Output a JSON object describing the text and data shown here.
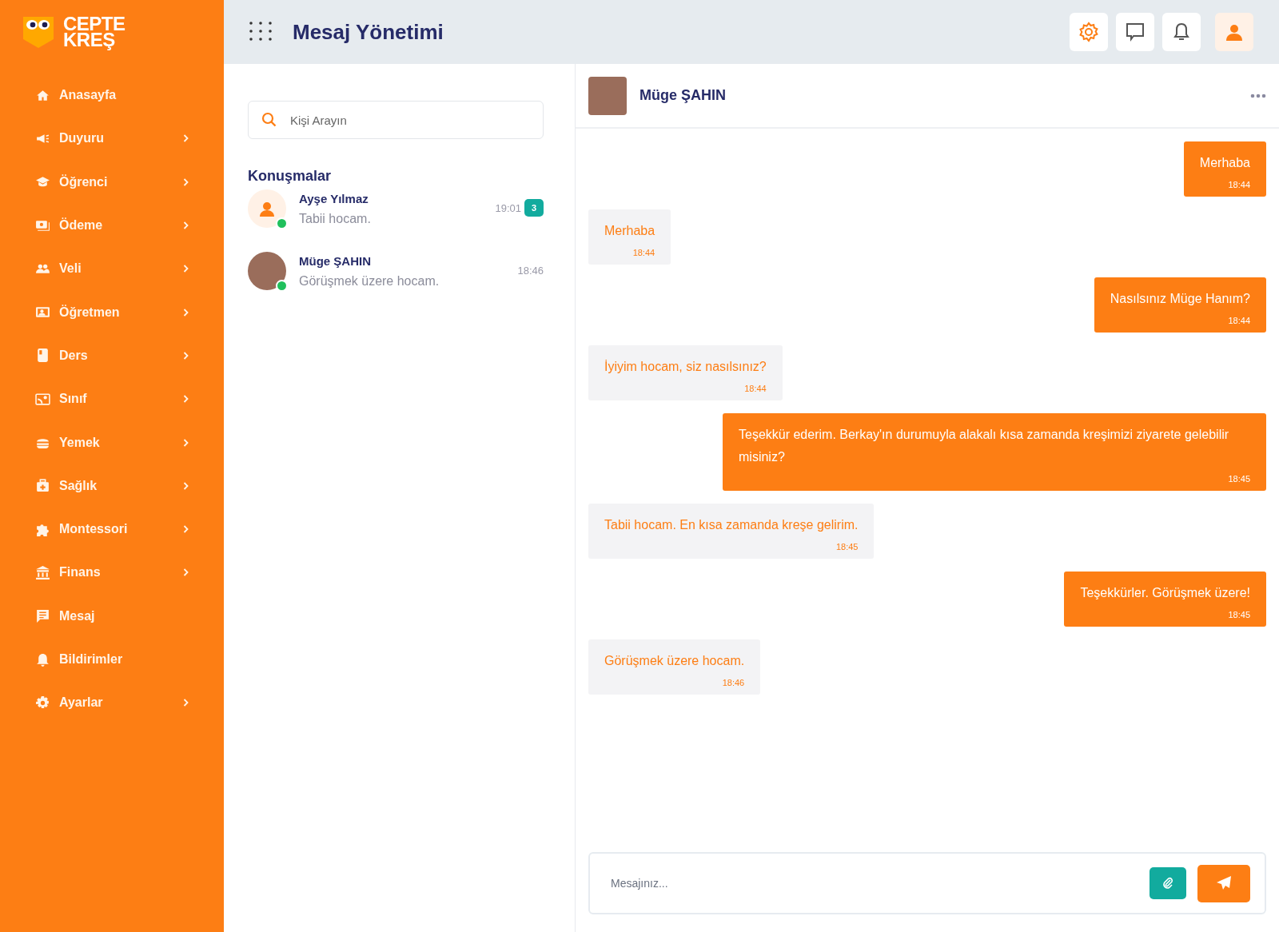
{
  "sidebar": {
    "logo": {
      "line_1": "CEPTE",
      "line_2": "KREŞ"
    },
    "items": [
      {
        "label": "Anasayfa",
        "expandable": false
      },
      {
        "label": "Duyuru",
        "expandable": true
      },
      {
        "label": "Öğrenci",
        "expandable": true
      },
      {
        "label": "Ödeme",
        "expandable": true
      },
      {
        "label": "Veli",
        "expandable": true
      },
      {
        "label": "Öğretmen",
        "expandable": true
      },
      {
        "label": "Ders",
        "expandable": true
      },
      {
        "label": "Sınıf",
        "expandable": true
      },
      {
        "label": "Yemek",
        "expandable": true
      },
      {
        "label": "Sağlık",
        "expandable": true
      },
      {
        "label": "Montessori",
        "expandable": true
      },
      {
        "label": "Finans",
        "expandable": true
      },
      {
        "label": "Mesaj",
        "expandable": false
      },
      {
        "label": "Bildirimler",
        "expandable": false
      },
      {
        "label": "Ayarlar",
        "expandable": true
      }
    ]
  },
  "header": {
    "title": "Mesaj Yönetimi"
  },
  "conversations": {
    "search": {
      "placeholder": "Kişi Arayın"
    },
    "heading": "Konuşmalar",
    "items": [
      {
        "name": "Ayşe Yılmaz",
        "preview": "Tabii hocam.",
        "time": "19:01",
        "unread": "3",
        "kind": "silhouette",
        "online": true
      },
      {
        "name": "Müge ŞAHIN",
        "preview": "Görüşmek üzere hocam.",
        "time": "18:46",
        "kind": "photo",
        "online": true
      }
    ]
  },
  "chat": {
    "contact": {
      "name": "Müge ŞAHIN"
    },
    "messages": [
      {
        "kind": "sent",
        "text": "Merhaba",
        "time": "18:44"
      },
      {
        "kind": "received",
        "text": "Merhaba",
        "time": "18:44"
      },
      {
        "kind": "sent",
        "text": "Nasılsınız Müge Hanım?",
        "time": "18:44"
      },
      {
        "kind": "received",
        "text": "İyiyim hocam, siz nasılsınız?",
        "time": "18:44"
      },
      {
        "kind": "sent",
        "text": "Teşekkür ederim. Berkay'ın durumuyla alakalı kısa zamanda kreşimizi ziyarete gelebilir misiniz?",
        "time": "18:45"
      },
      {
        "kind": "received",
        "text": "Tabii hocam. En kısa zamanda kreşe gelirim.",
        "time": "18:45"
      },
      {
        "kind": "sent",
        "text": "Teşekkürler. Görüşmek üzere!",
        "time": "18:45"
      },
      {
        "kind": "received",
        "text": "Görüşmek üzere hocam.",
        "time": "18:46"
      }
    ],
    "composer": {
      "placeholder": "Mesajınız..."
    }
  }
}
